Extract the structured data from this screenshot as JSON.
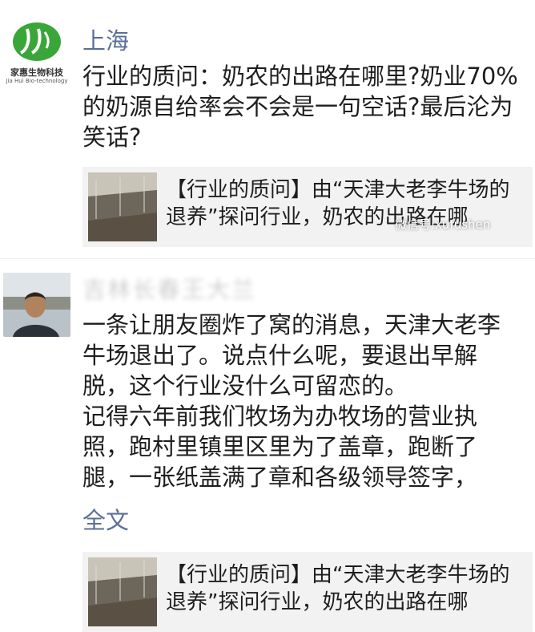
{
  "post1": {
    "avatar_brand": "家惠生物科技",
    "avatar_brand_en": "Jia Hui Bio-technology",
    "username": "上海",
    "text": "行业的质问：奶农的出路在哪里?奶业70%的奶源自给率会不会是一句空话?最后沦为笑话?",
    "link_title": "【行业的质问】由“天津大老李牛场的退养”探问行业，奶农的出路在哪",
    "watermark": "微信号:xufushen"
  },
  "post2": {
    "username_blurred": "吉林长春王大兰",
    "paragraph1": "一条让朋友圈炸了窝的消息，天津大老李牛场退出了。说点什么呢，要退出早解脱，这个行业没什么可留恋的。",
    "paragraph2": "记得六年前我们牧场为办牧场的营业执照，跑村里镇里区里为了盖章，跑断了腿，一张纸盖满了章和各级领导签字，",
    "fulltext_label": "全文",
    "link_title": "【行业的质问】由“天津大老李牛场的退养”探问行业，奶农的出路在哪"
  },
  "colors": {
    "link_name": "#5b6f96",
    "card_bg": "#f2f2f2",
    "logo_green": "#3aa63a"
  },
  "icons": [
    "logo-icon",
    "avatar-photo",
    "barn-thumbnail"
  ]
}
